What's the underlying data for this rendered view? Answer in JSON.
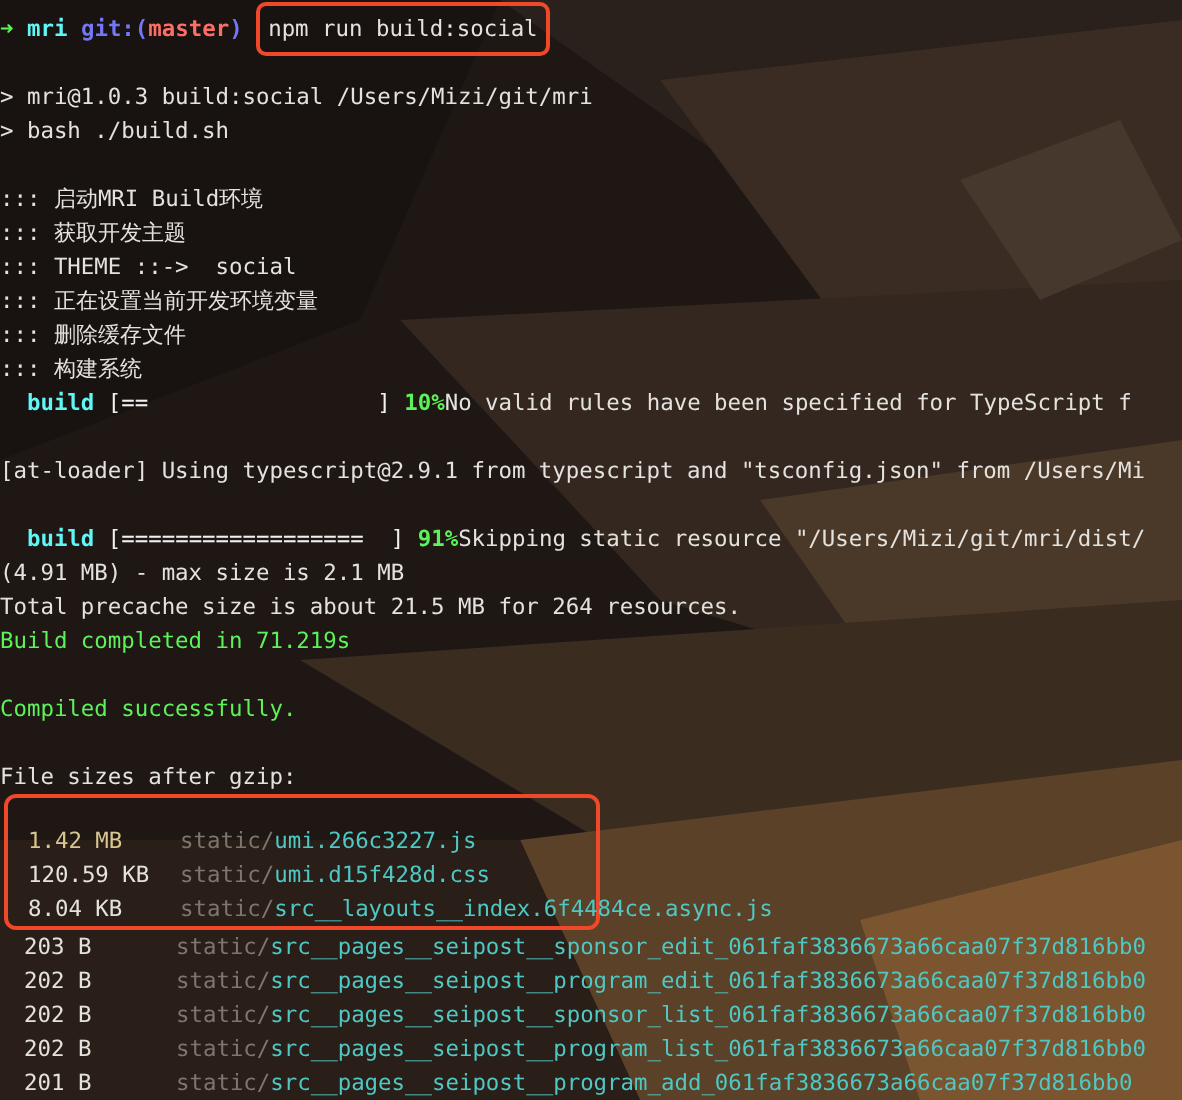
{
  "terminal": {
    "lines": [
      {
        "kind": "prompt",
        "arrow": "➜",
        "dir": "mri",
        "git_open": "git:(",
        "branch": "master",
        "git_close": ")",
        "command": "npm run build:social",
        "highlighted": true
      },
      {
        "kind": "blank"
      },
      {
        "kind": "text",
        "text": "> mri@1.0.3 build:social /Users/Mizi/git/mri"
      },
      {
        "kind": "text",
        "text": "> bash ./build.sh"
      },
      {
        "kind": "blank"
      },
      {
        "kind": "text",
        "text": "::: 启动MRI Build环境"
      },
      {
        "kind": "text",
        "text": "::: 获取开发主题"
      },
      {
        "kind": "text",
        "text": "::: THEME ::->  social"
      },
      {
        "kind": "text",
        "text": "::: 正在设置当前开发环境变量"
      },
      {
        "kind": "text",
        "text": "::: 删除缓存文件"
      },
      {
        "kind": "text",
        "text": "::: 构建系统"
      },
      {
        "kind": "progress",
        "label": "build",
        "bar": "[==                 ]",
        "percent": "10%",
        "message": "No valid rules have been specified for TypeScript f"
      },
      {
        "kind": "blank"
      },
      {
        "kind": "text",
        "text": "[at-loader] Using typescript@2.9.1 from typescript and \"tsconfig.json\" from /Users/Mi"
      },
      {
        "kind": "blank"
      },
      {
        "kind": "progress",
        "label": "build",
        "bar": "[==================  ]",
        "percent": "91%",
        "message": "Skipping static resource \"/Users/Mizi/git/mri/dist/"
      },
      {
        "kind": "text",
        "text": "(4.91 MB) - max size is 2.1 MB"
      },
      {
        "kind": "text",
        "text": "Total precache size is about 21.5 MB for 264 resources."
      },
      {
        "kind": "success",
        "text": "Build completed in 71.219s"
      },
      {
        "kind": "blank"
      },
      {
        "kind": "success",
        "text": "Compiled successfully."
      },
      {
        "kind": "blank"
      },
      {
        "kind": "text",
        "text": "File sizes after gzip:"
      },
      {
        "kind": "files",
        "highlighted": true,
        "files": [
          {
            "size": "1.42 MB",
            "large": true,
            "dir": "static/",
            "name": "umi.266c3227.js"
          },
          {
            "size": "120.59 KB",
            "large": false,
            "dir": "static/",
            "name": "umi.d15f428d.css"
          },
          {
            "size": "8.04 KB",
            "large": false,
            "dir": "static/",
            "name": "src__layouts__index.6f4484ce.async.js"
          }
        ]
      },
      {
        "kind": "files",
        "highlighted": false,
        "files": [
          {
            "size": "203 B",
            "large": false,
            "dir": "static/",
            "name": "src__pages__seipost__sponsor_edit_061faf3836673a66caa07f37d816bb0"
          },
          {
            "size": "202 B",
            "large": false,
            "dir": "static/",
            "name": "src__pages__seipost__program_edit_061faf3836673a66caa07f37d816bb0"
          },
          {
            "size": "202 B",
            "large": false,
            "dir": "static/",
            "name": "src__pages__seipost__sponsor_list_061faf3836673a66caa07f37d816bb0"
          },
          {
            "size": "202 B",
            "large": false,
            "dir": "static/",
            "name": "src__pages__seipost__program_list_061faf3836673a66caa07f37d816bb0"
          },
          {
            "size": "201 B",
            "large": false,
            "dir": "static/",
            "name": "src__pages__seipost__program_add_061faf3836673a66caa07f37d816bb0"
          }
        ]
      }
    ]
  }
}
